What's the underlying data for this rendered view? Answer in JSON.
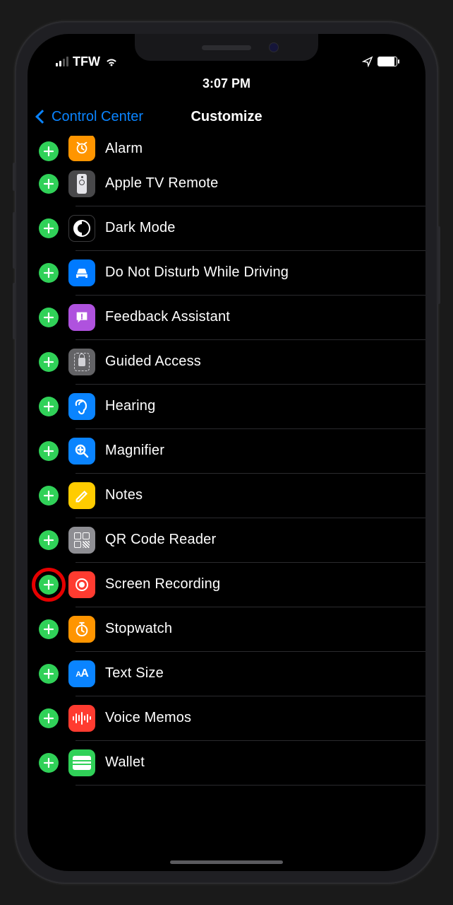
{
  "status": {
    "carrier": "TFW",
    "time": "3:07 PM"
  },
  "nav": {
    "back_label": "Control Center",
    "title": "Customize"
  },
  "list": {
    "items": [
      {
        "id": "alarm",
        "label": "Alarm",
        "icon_bg": "bg-orange",
        "icon_type": "alarm",
        "partial": true
      },
      {
        "id": "apple-tv-remote",
        "label": "Apple TV Remote",
        "icon_bg": "bg-remote",
        "icon_type": "remote"
      },
      {
        "id": "dark-mode",
        "label": "Dark Mode",
        "icon_bg": "bg-black",
        "icon_type": "darkmode"
      },
      {
        "id": "dnd-driving",
        "label": "Do Not Disturb While Driving",
        "icon_bg": "bg-blue",
        "icon_type": "car"
      },
      {
        "id": "feedback-assistant",
        "label": "Feedback Assistant",
        "icon_bg": "bg-purple",
        "icon_type": "feedback"
      },
      {
        "id": "guided-access",
        "label": "Guided Access",
        "icon_bg": "bg-gray",
        "icon_type": "lockbox"
      },
      {
        "id": "hearing",
        "label": "Hearing",
        "icon_bg": "bg-blue2",
        "icon_type": "ear"
      },
      {
        "id": "magnifier",
        "label": "Magnifier",
        "icon_bg": "bg-blue3",
        "icon_type": "magnifier"
      },
      {
        "id": "notes",
        "label": "Notes",
        "icon_bg": "bg-yellow",
        "icon_type": "notes"
      },
      {
        "id": "qr-reader",
        "label": "QR Code Reader",
        "icon_bg": "bg-gray2",
        "icon_type": "qr"
      },
      {
        "id": "screen-recording",
        "label": "Screen Recording",
        "icon_bg": "bg-red",
        "icon_type": "record",
        "highlighted": true
      },
      {
        "id": "stopwatch",
        "label": "Stopwatch",
        "icon_bg": "bg-orange2",
        "icon_type": "stopwatch"
      },
      {
        "id": "text-size",
        "label": "Text Size",
        "icon_bg": "bg-blue4",
        "icon_type": "textsize"
      },
      {
        "id": "voice-memos",
        "label": "Voice Memos",
        "icon_bg": "bg-red2",
        "icon_type": "wave"
      },
      {
        "id": "wallet",
        "label": "Wallet",
        "icon_bg": "bg-teal",
        "icon_type": "wallet"
      }
    ]
  }
}
